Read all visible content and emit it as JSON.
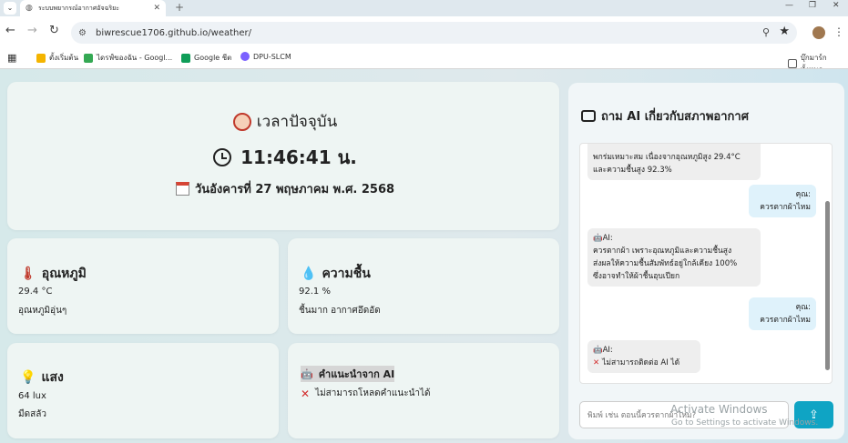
{
  "browser": {
    "tab_title": "ระบบพยากรณ์อากาศอัจฉริยะ",
    "url": "biwrescue1706.github.io/weather/",
    "bookmarks": [
      {
        "label": "ตั้งเริ่มต้น",
        "color": "#f4b400"
      },
      {
        "label": "ไดรฟ์ของฉัน - Googl...",
        "color": "#34a853"
      },
      {
        "label": "Google ชีต",
        "color": "#0f9d58"
      },
      {
        "label": "DPU-SLCM",
        "color": "#7b61ff"
      }
    ],
    "all_bookmarks": "บุ๊กมาร์กทั้งหมด"
  },
  "clock": {
    "title": "เวลาปัจจุบัน",
    "time": "11:46:41 น.",
    "date": "วันอังคารที่ 27 พฤษภาคม พ.ศ. 2568"
  },
  "temperature": {
    "title": "อุณหภูมิ",
    "value": "29.4 °C",
    "desc": "อุณหภูมิอุ่นๆ"
  },
  "humidity": {
    "title": "ความชื้น",
    "value": "92.1 %",
    "desc": "ชื้นมาก อากาศอึดอัด"
  },
  "light": {
    "title": "แสง",
    "value": "64 lux",
    "desc": "มืดสลัว"
  },
  "ai_advice": {
    "title": "คำแนะนำจาก AI",
    "error": "ไม่สามารถโหลดคำแนะนำได้"
  },
  "chat": {
    "title": "ถาม AI เกี่ยวกับสภาพอากาศ",
    "messages": [
      {
        "sender": "",
        "text1": "พกร่มเหมาะสม เนื่องจากอุณหภูมิสูง 29.4°C",
        "text2": "และความชื้นสูง 92.3%"
      },
      {
        "sender": "คุณ:",
        "text1": "ควรตากผ้าไหม"
      },
      {
        "sender": "AI:",
        "text1": "ควรตากผ้า เพราะอุณหภูมิและความชื้นสูง",
        "text2": "ส่งผลให้ความชื้นสัมพัทธ์อยู่ใกล้เคียง 100%",
        "text3": "ซึ่งอาจทำให้ผ้าชื้นอุบเปียก"
      },
      {
        "sender": "คุณ:",
        "text1": "ควรตากผ้าไหม"
      },
      {
        "sender": "AI:",
        "text1": "ไม่สามารถติดต่อ AI ได้"
      }
    ],
    "input_placeholder": "พิมพ์ เช่น ตอนนี้ควรตากผ้าไหม?"
  },
  "watermark": {
    "line1": "Activate Windows",
    "line2": "Go to Settings to activate Windows."
  }
}
